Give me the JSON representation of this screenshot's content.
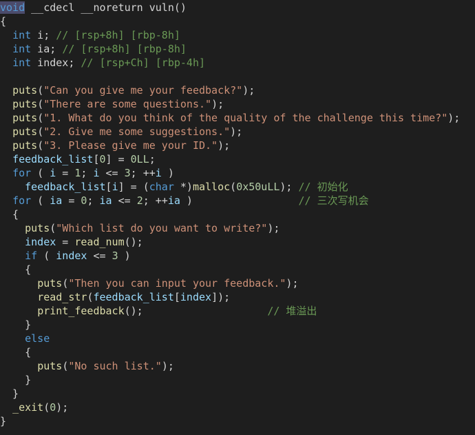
{
  "editor": {
    "theme_colors": {
      "background": "#1e1e1e",
      "keyword": "#569cd6",
      "string": "#ce9178",
      "comment": "#6a9955",
      "number": "#b5cea8",
      "function": "#dcdcaa",
      "variable": "#9cdcfe",
      "default": "#d4d4d4",
      "selection": "#4b4b6b"
    },
    "lines": [
      [
        {
          "t": "void",
          "c": "kw",
          "sel": true
        },
        {
          "t": " __cdecl __noreturn vuln()",
          "c": "plain"
        }
      ],
      [
        {
          "t": "{",
          "c": "plain"
        }
      ],
      [
        {
          "t": "  ",
          "c": "plain"
        },
        {
          "t": "int",
          "c": "kw"
        },
        {
          "t": " i; ",
          "c": "plain"
        },
        {
          "t": "// [rsp+8h] [rbp-8h]",
          "c": "cmt"
        }
      ],
      [
        {
          "t": "  ",
          "c": "plain"
        },
        {
          "t": "int",
          "c": "kw"
        },
        {
          "t": " ia; ",
          "c": "plain"
        },
        {
          "t": "// [rsp+8h] [rbp-8h]",
          "c": "cmt"
        }
      ],
      [
        {
          "t": "  ",
          "c": "plain"
        },
        {
          "t": "int",
          "c": "kw"
        },
        {
          "t": " index; ",
          "c": "plain"
        },
        {
          "t": "// [rsp+Ch] [rbp-4h]",
          "c": "cmt"
        }
      ],
      [
        {
          "t": "",
          "c": "plain"
        }
      ],
      [
        {
          "t": "  ",
          "c": "plain"
        },
        {
          "t": "puts",
          "c": "fn"
        },
        {
          "t": "(",
          "c": "plain"
        },
        {
          "t": "\"Can you give me your feedback?\"",
          "c": "str"
        },
        {
          "t": ");",
          "c": "plain"
        }
      ],
      [
        {
          "t": "  ",
          "c": "plain"
        },
        {
          "t": "puts",
          "c": "fn"
        },
        {
          "t": "(",
          "c": "plain"
        },
        {
          "t": "\"There are some questions.\"",
          "c": "str"
        },
        {
          "t": ");",
          "c": "plain"
        }
      ],
      [
        {
          "t": "  ",
          "c": "plain"
        },
        {
          "t": "puts",
          "c": "fn"
        },
        {
          "t": "(",
          "c": "plain"
        },
        {
          "t": "\"1. What do you think of the quality of the challenge this time?\"",
          "c": "str"
        },
        {
          "t": ");",
          "c": "plain"
        }
      ],
      [
        {
          "t": "  ",
          "c": "plain"
        },
        {
          "t": "puts",
          "c": "fn"
        },
        {
          "t": "(",
          "c": "plain"
        },
        {
          "t": "\"2. Give me some suggestions.\"",
          "c": "str"
        },
        {
          "t": ");",
          "c": "plain"
        }
      ],
      [
        {
          "t": "  ",
          "c": "plain"
        },
        {
          "t": "puts",
          "c": "fn"
        },
        {
          "t": "(",
          "c": "plain"
        },
        {
          "t": "\"3. Please give me your ID.\"",
          "c": "str"
        },
        {
          "t": ");",
          "c": "plain"
        }
      ],
      [
        {
          "t": "  ",
          "c": "plain"
        },
        {
          "t": "feedback_list",
          "c": "var"
        },
        {
          "t": "[",
          "c": "plain"
        },
        {
          "t": "0",
          "c": "num"
        },
        {
          "t": "] = ",
          "c": "plain"
        },
        {
          "t": "0LL",
          "c": "num"
        },
        {
          "t": ";",
          "c": "plain"
        }
      ],
      [
        {
          "t": "  ",
          "c": "plain"
        },
        {
          "t": "for",
          "c": "kw"
        },
        {
          "t": " ( ",
          "c": "plain"
        },
        {
          "t": "i",
          "c": "var"
        },
        {
          "t": " = ",
          "c": "plain"
        },
        {
          "t": "1",
          "c": "num"
        },
        {
          "t": "; ",
          "c": "plain"
        },
        {
          "t": "i",
          "c": "var"
        },
        {
          "t": " <= ",
          "c": "plain"
        },
        {
          "t": "3",
          "c": "num"
        },
        {
          "t": "; ++",
          "c": "plain"
        },
        {
          "t": "i",
          "c": "var"
        },
        {
          "t": " )",
          "c": "plain"
        }
      ],
      [
        {
          "t": "    ",
          "c": "plain"
        },
        {
          "t": "feedback_list",
          "c": "var"
        },
        {
          "t": "[",
          "c": "plain"
        },
        {
          "t": "i",
          "c": "var"
        },
        {
          "t": "] = (",
          "c": "plain"
        },
        {
          "t": "char",
          "c": "kw"
        },
        {
          "t": " *)",
          "c": "plain"
        },
        {
          "t": "malloc",
          "c": "fn"
        },
        {
          "t": "(",
          "c": "plain"
        },
        {
          "t": "0x50uLL",
          "c": "num"
        },
        {
          "t": "); ",
          "c": "plain"
        },
        {
          "t": "// 初始化",
          "c": "cmt"
        }
      ],
      [
        {
          "t": "  ",
          "c": "plain"
        },
        {
          "t": "for",
          "c": "kw"
        },
        {
          "t": " ( ",
          "c": "plain"
        },
        {
          "t": "ia",
          "c": "var"
        },
        {
          "t": " = ",
          "c": "plain"
        },
        {
          "t": "0",
          "c": "num"
        },
        {
          "t": "; ",
          "c": "plain"
        },
        {
          "t": "ia",
          "c": "var"
        },
        {
          "t": " <= ",
          "c": "plain"
        },
        {
          "t": "2",
          "c": "num"
        },
        {
          "t": "; ++",
          "c": "plain"
        },
        {
          "t": "ia",
          "c": "var"
        },
        {
          "t": " )                 ",
          "c": "plain"
        },
        {
          "t": "// 三次写机会",
          "c": "cmt"
        }
      ],
      [
        {
          "t": "  {",
          "c": "plain"
        }
      ],
      [
        {
          "t": "    ",
          "c": "plain"
        },
        {
          "t": "puts",
          "c": "fn"
        },
        {
          "t": "(",
          "c": "plain"
        },
        {
          "t": "\"Which list do you want to write?\"",
          "c": "str"
        },
        {
          "t": ");",
          "c": "plain"
        }
      ],
      [
        {
          "t": "    ",
          "c": "plain"
        },
        {
          "t": "index",
          "c": "var"
        },
        {
          "t": " = ",
          "c": "plain"
        },
        {
          "t": "read_num",
          "c": "fn"
        },
        {
          "t": "();",
          "c": "plain"
        }
      ],
      [
        {
          "t": "    ",
          "c": "plain"
        },
        {
          "t": "if",
          "c": "kw"
        },
        {
          "t": " ( ",
          "c": "plain"
        },
        {
          "t": "index",
          "c": "var"
        },
        {
          "t": " <= ",
          "c": "plain"
        },
        {
          "t": "3",
          "c": "num"
        },
        {
          "t": " )",
          "c": "plain"
        }
      ],
      [
        {
          "t": "    {",
          "c": "plain"
        }
      ],
      [
        {
          "t": "      ",
          "c": "plain"
        },
        {
          "t": "puts",
          "c": "fn"
        },
        {
          "t": "(",
          "c": "plain"
        },
        {
          "t": "\"Then you can input your feedback.\"",
          "c": "str"
        },
        {
          "t": ");",
          "c": "plain"
        }
      ],
      [
        {
          "t": "      ",
          "c": "plain"
        },
        {
          "t": "read_str",
          "c": "fn"
        },
        {
          "t": "(",
          "c": "plain"
        },
        {
          "t": "feedback_list",
          "c": "var"
        },
        {
          "t": "[",
          "c": "plain"
        },
        {
          "t": "index",
          "c": "var"
        },
        {
          "t": "]);",
          "c": "plain"
        }
      ],
      [
        {
          "t": "      ",
          "c": "plain"
        },
        {
          "t": "print_feedback",
          "c": "fn"
        },
        {
          "t": "();                    ",
          "c": "plain"
        },
        {
          "t": "// 堆溢出",
          "c": "cmt"
        }
      ],
      [
        {
          "t": "    }",
          "c": "plain"
        }
      ],
      [
        {
          "t": "    ",
          "c": "plain"
        },
        {
          "t": "else",
          "c": "kw"
        }
      ],
      [
        {
          "t": "    {",
          "c": "plain"
        }
      ],
      [
        {
          "t": "      ",
          "c": "plain"
        },
        {
          "t": "puts",
          "c": "fn"
        },
        {
          "t": "(",
          "c": "plain"
        },
        {
          "t": "\"No such list.\"",
          "c": "str"
        },
        {
          "t": ");",
          "c": "plain"
        }
      ],
      [
        {
          "t": "    }",
          "c": "plain"
        }
      ],
      [
        {
          "t": "  }",
          "c": "plain"
        }
      ],
      [
        {
          "t": "  ",
          "c": "plain"
        },
        {
          "t": "_exit",
          "c": "fn"
        },
        {
          "t": "(",
          "c": "plain"
        },
        {
          "t": "0",
          "c": "num"
        },
        {
          "t": ");",
          "c": "plain"
        }
      ],
      [
        {
          "t": "}",
          "c": "plain"
        }
      ]
    ]
  }
}
